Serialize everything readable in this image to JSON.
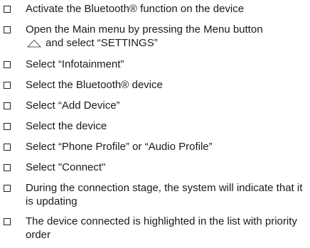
{
  "checklist": {
    "items": [
      {
        "text": "Activate the Bluetooth® function on the device"
      },
      {
        "text_before_icon": "Open the Main menu by pressing the Menu button",
        "icon": "home-icon",
        "text_after_icon": "and select “SETTINGS”"
      },
      {
        "text": "Select “Infotainment”"
      },
      {
        "text": "Select the Bluetooth® device"
      },
      {
        "text": "Select “Add Device”"
      },
      {
        "text": "Select the device"
      },
      {
        "text": "Select “Phone Profile” or “Audio Profile”"
      },
      {
        "text": "Select \"Connect\""
      },
      {
        "text": "During the connection stage, the system will indicate that it is updating"
      },
      {
        "text": "The device connected is highlighted in the list with priority order"
      }
    ]
  }
}
